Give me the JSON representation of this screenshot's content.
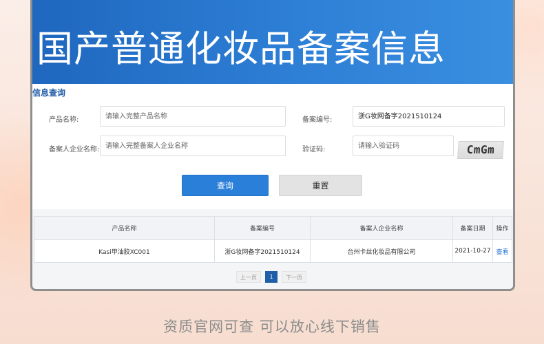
{
  "banner": {
    "title": "国产普通化妆品备案信息"
  },
  "query": {
    "section_title": "信息查询",
    "product_name_label": "产品名称:",
    "product_name_placeholder": "请输入完整产品名称",
    "record_no_label": "备案编号:",
    "record_no_value": "浙G妆网备字2021510124",
    "company_label": "备案人企业名称:",
    "company_placeholder": "请输入完整备案人企业名称",
    "captcha_label": "验证码:",
    "captcha_placeholder": "请输入验证码",
    "captcha_text": "CmGm",
    "query_button": "查询",
    "reset_button": "重置"
  },
  "results": {
    "columns": [
      "产品名称",
      "备案编号",
      "备案人企业名称",
      "备案日期",
      "操作"
    ],
    "rows": [
      {
        "product": "Kasi甲油胶XC001",
        "record_no": "浙G妆网备字2021510124",
        "company": "台州卡丝化妆品有限公司",
        "date": "2021-10-27",
        "action": "查看"
      }
    ]
  },
  "pagination": {
    "prev": "上一页",
    "current": "1",
    "next": "下一页"
  },
  "footer": {
    "slogan": "资质官网可查 可以放心线下销售"
  },
  "colors": {
    "banner_blue": "#2e7fd6",
    "primary_button": "#2a7fd8",
    "section_title": "#1c5aa8",
    "link": "#1f6fd0"
  }
}
